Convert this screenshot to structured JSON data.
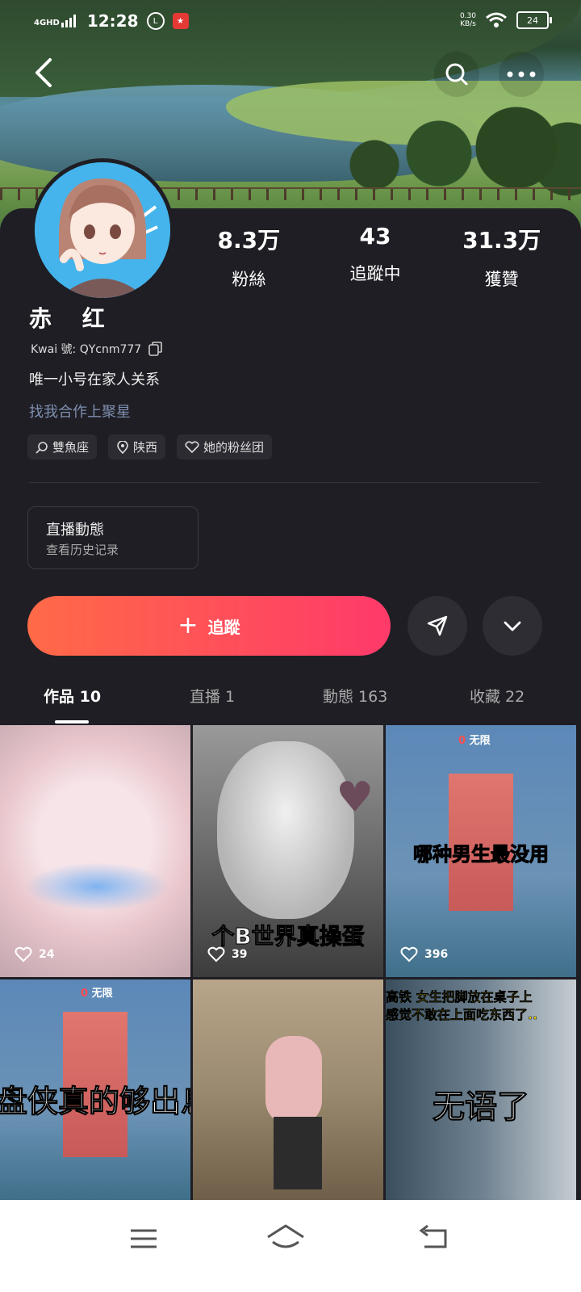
{
  "status_bar": {
    "network": "4GHD",
    "time": "12:28",
    "speed_value": "0.30",
    "speed_unit": "KB/s",
    "battery": "24"
  },
  "profile": {
    "name": "赤 红",
    "kwai_id": "Kwai 號: QYcnm777",
    "bio": "唯一小号在家人关系",
    "link": "找我合作上聚星",
    "tags": [
      "雙魚座",
      "陕西",
      "她的粉丝团"
    ],
    "stats": [
      {
        "value": "8.3万",
        "label": "粉絲"
      },
      {
        "value": "43",
        "label": "追蹤中"
      },
      {
        "value": "31.3万",
        "label": "獲贊"
      }
    ]
  },
  "live_card": {
    "title": "直播動態",
    "subtitle": "查看历史记录"
  },
  "follow_button": {
    "label": "追蹤"
  },
  "tabs": [
    {
      "label": "作品 10"
    },
    {
      "label": "直播 1"
    },
    {
      "label": "動態 163"
    },
    {
      "label": "收藏 22"
    }
  ],
  "posts": [
    {
      "likes": "24"
    },
    {
      "likes": "39",
      "caption": "个B世界真操蛋"
    },
    {
      "likes": "396",
      "caption": "哪种男生最没用",
      "badge": "无限",
      "badge_num": "0"
    },
    {
      "caption": "盘侠真的够出息的男生",
      "badge": "无限",
      "badge_num": "0"
    },
    {},
    {
      "caption_top": "高铁 女生把脚放在桌子上",
      "caption_top2": "感觉不敢在上面吃东西了..",
      "caption": "无语了"
    }
  ],
  "colors": {
    "accent_start": "#ff6a47",
    "accent_end": "#ff3a6a",
    "background": "#1e1e24",
    "link": "#7f8fb0"
  }
}
